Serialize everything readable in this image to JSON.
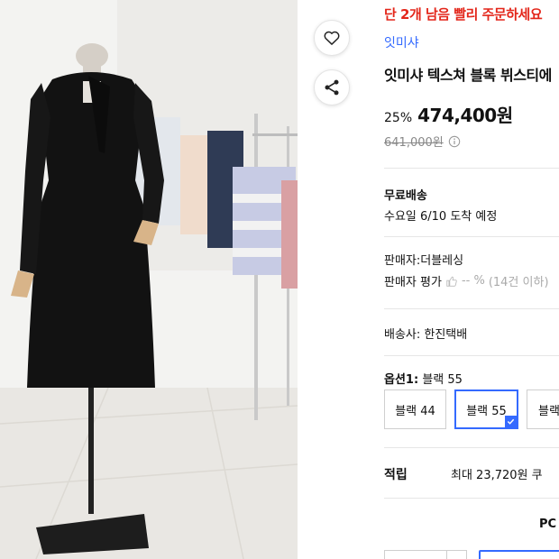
{
  "product_image": {
    "alt": "black dress on mannequin"
  },
  "actions": {
    "wishlist_icon": "heart-icon",
    "share_icon": "share-icon"
  },
  "info": {
    "stock_notice": "단 2개 남음 빨리 주문하세요",
    "brand": "잇미샤",
    "title": "잇미샤 텍스쳐 블록 뷔스티에",
    "discount": "25%",
    "price": "474,400원",
    "original_price": "641,000원"
  },
  "shipping": {
    "label": "무료배송",
    "arrival": "수요일 6/10 도착 예정"
  },
  "seller": {
    "name": "판매자:더블레싱",
    "rating_label": "판매자 평가",
    "rating_value": "-- %",
    "rating_count": "(14건 이하)"
  },
  "carrier": "배송사: 한진택배",
  "option": {
    "label": "옵션1:",
    "selected": "블랙 55",
    "choices": [
      "블랙 44",
      "블랙 55",
      "블랙"
    ]
  },
  "points": {
    "label": "적립",
    "text": "최대 23,720원 쿠"
  },
  "pc_label": "PC",
  "colors": {
    "accent": "#346aff",
    "alert": "#e3261a"
  }
}
